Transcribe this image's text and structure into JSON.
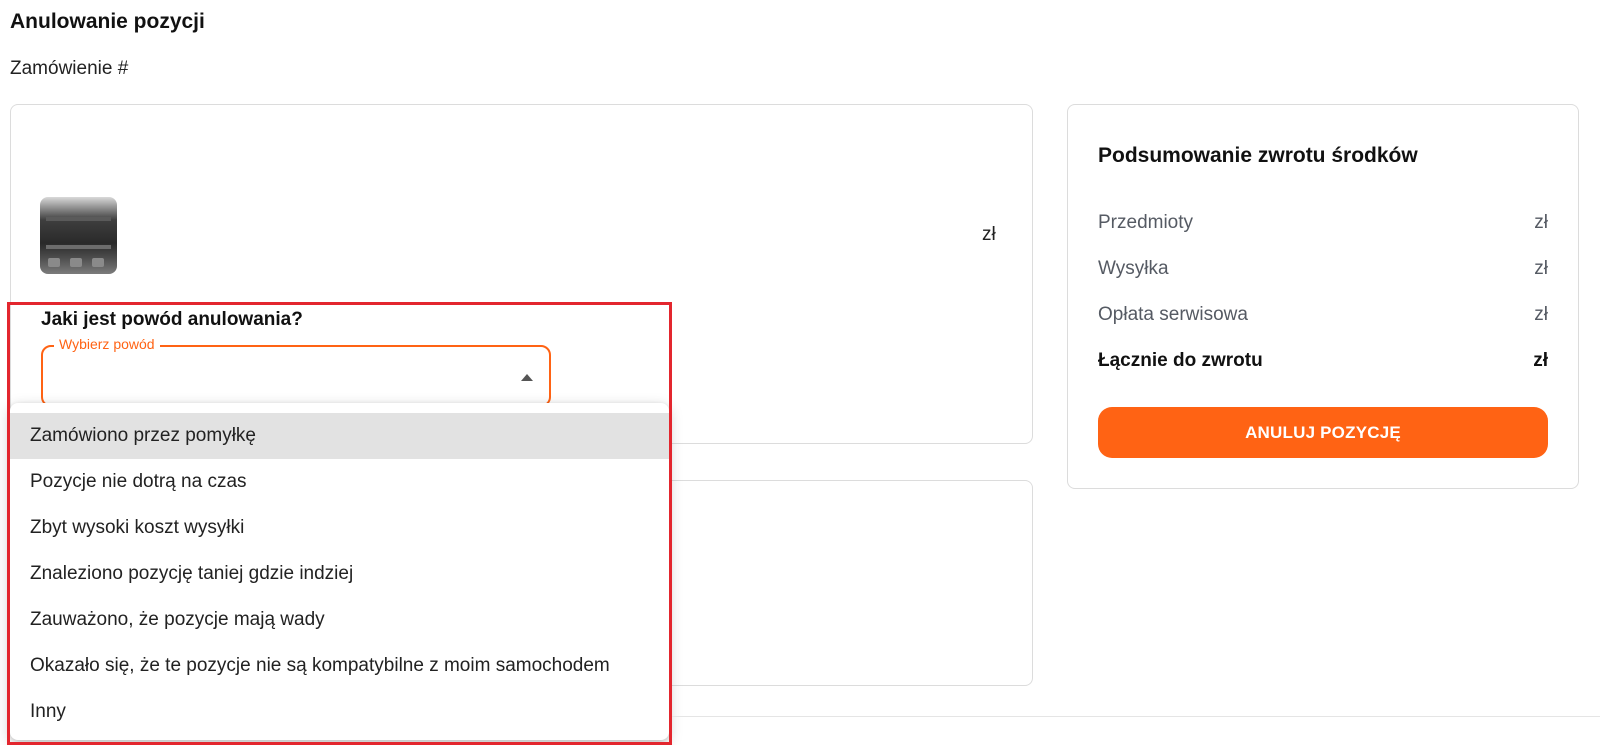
{
  "page": {
    "title": "Anulowanie pozycji",
    "order_label": "Zamówienie #"
  },
  "item": {
    "price": "zł"
  },
  "reason": {
    "question": "Jaki jest powód anulowania?",
    "select_label": "Wybierz powód",
    "options": [
      "Zamówiono przez pomyłkę",
      "Pozycje nie dotrą na czas",
      "Zbyt wysoki koszt wysyłki",
      "Znaleziono pozycję taniej gdzie indziej",
      "Zauważono, że pozycje mają wady",
      "Okazało się, że te pozycje nie są kompatybilne z moim samochodem",
      "Inny"
    ],
    "highlighted_option": "Zamówiono przez pomyłkę"
  },
  "summary": {
    "title": "Podsumowanie zwrotu środków",
    "rows": [
      {
        "label": "Przedmioty",
        "value": "zł"
      },
      {
        "label": "Wysyłka",
        "value": "zł"
      },
      {
        "label": "Opłata serwisowa",
        "value": "zł"
      },
      {
        "label": "Łącznie do zwrotu",
        "value": "zł"
      }
    ],
    "button_label": "ANULUJ POZYCJĘ"
  },
  "colors": {
    "accent": "#ff6314",
    "highlight_border": "#e3262e",
    "selected_option_bg": "#e2e2e2"
  }
}
